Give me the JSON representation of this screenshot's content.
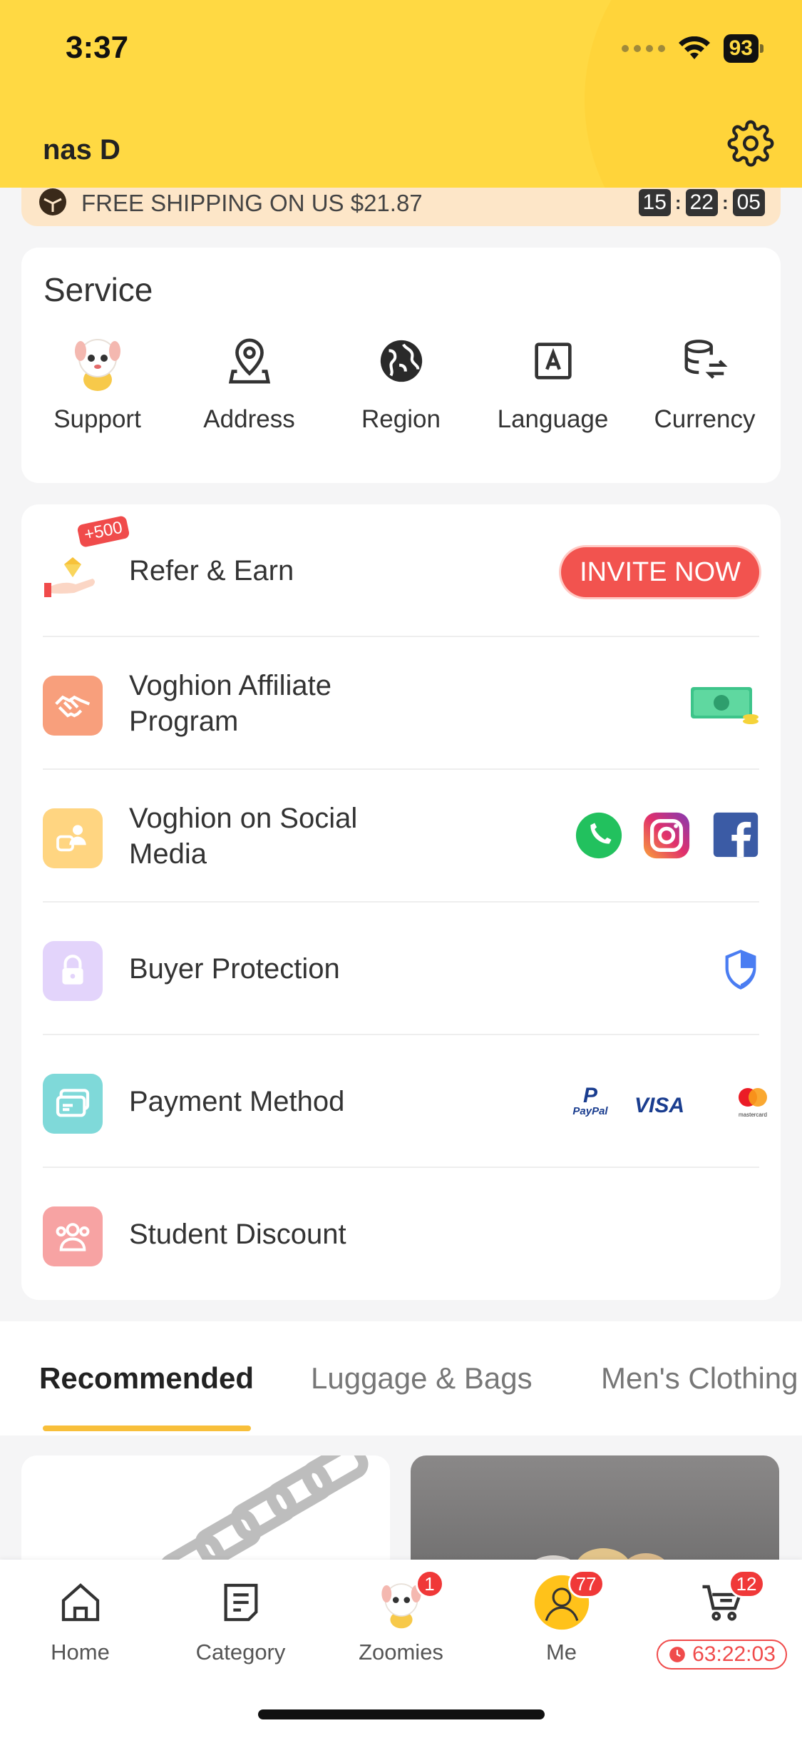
{
  "status_bar": {
    "time": "3:37",
    "battery": "93"
  },
  "header": {
    "user_name": "nas D"
  },
  "shipping_banner": {
    "text": "FREE SHIPPING ON US $21.87",
    "timer": [
      "15",
      "22",
      "05"
    ]
  },
  "service": {
    "title": "Service",
    "items": [
      {
        "label": "Support",
        "icon": "support-mascot-icon"
      },
      {
        "label": "Address",
        "icon": "location-pin-icon"
      },
      {
        "label": "Region",
        "icon": "globe-icon"
      },
      {
        "label": "Language",
        "icon": "language-icon"
      },
      {
        "label": "Currency",
        "icon": "currency-exchange-icon"
      }
    ]
  },
  "menu": {
    "refer": {
      "label": "Refer & Earn",
      "badge": "+500",
      "button": "INVITE NOW"
    },
    "affiliate": {
      "label": "Voghion Affiliate Program"
    },
    "social": {
      "label": "Voghion on Social Media"
    },
    "protection": {
      "label": "Buyer Protection"
    },
    "payment": {
      "label": "Payment Method",
      "paypal": "PayPal",
      "visa": "VISA",
      "mastercard": "mastercard"
    },
    "student": {
      "label": "Student Discount"
    }
  },
  "tabs": [
    "Recommended",
    "Luggage & Bags",
    "Men's Clothing"
  ],
  "bottom_nav": {
    "home": "Home",
    "category": "Category",
    "zoomies": "Zoomies",
    "zoomies_badge": "1",
    "me": "Me",
    "me_badge": "77",
    "cart_badge": "12",
    "cart_timer": "63:22:03"
  },
  "colors": {
    "accent": "#ffd943",
    "invite": "#f2534f",
    "tab_underline": "#f8bf3a"
  }
}
